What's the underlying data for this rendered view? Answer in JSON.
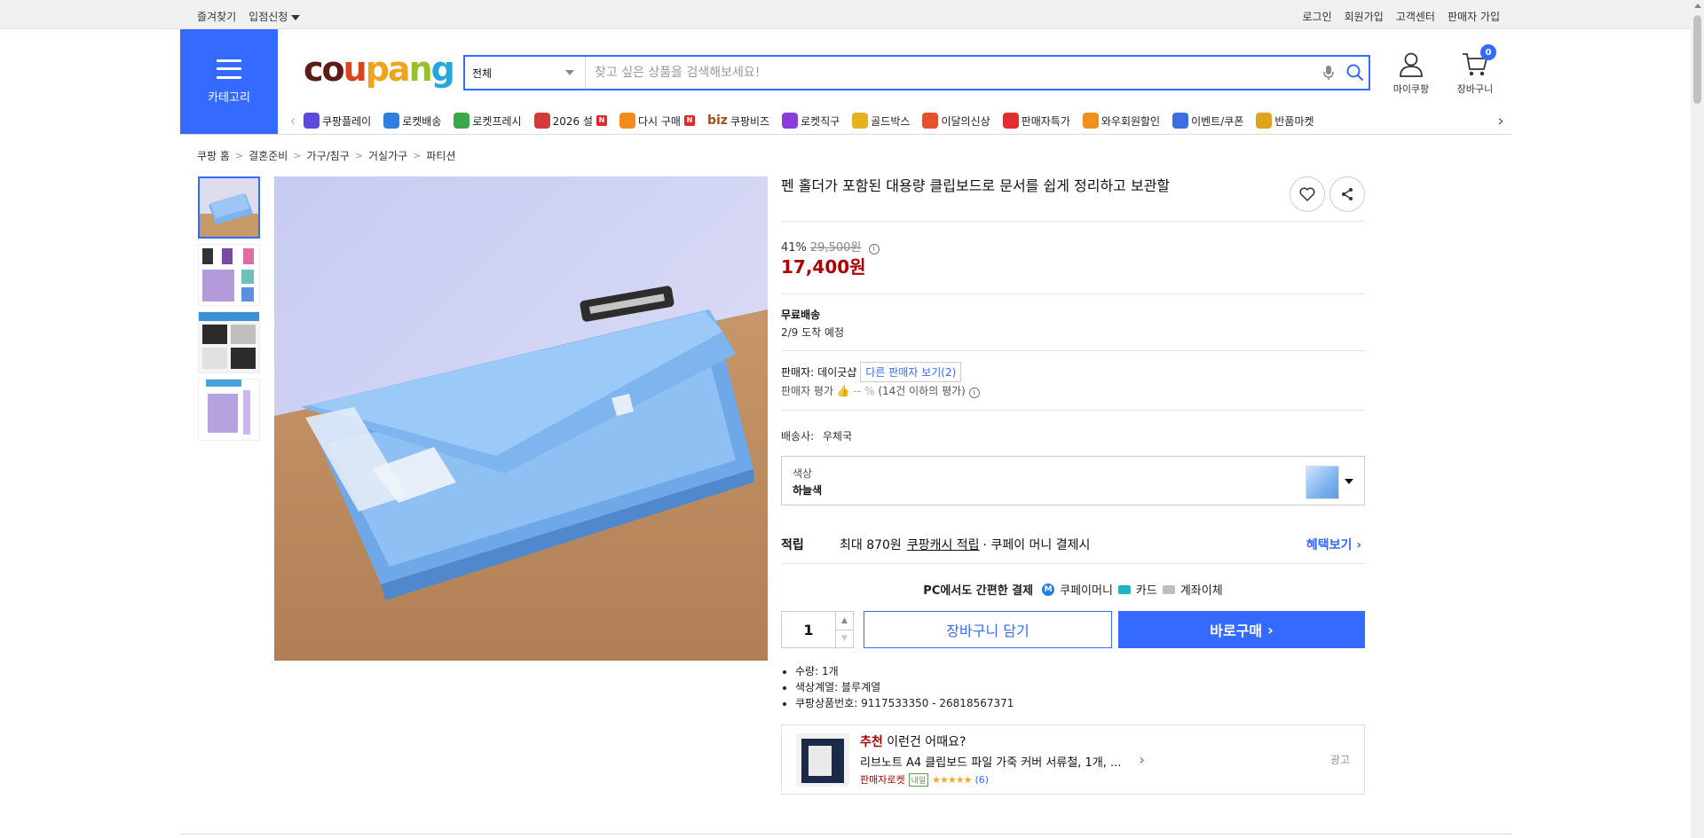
{
  "topbar": {
    "left": [
      "즐겨찾기",
      "입점신청"
    ],
    "right": [
      "로그인",
      "회원가입",
      "고객센터",
      "판매자 가입"
    ]
  },
  "header": {
    "category_label": "카테고리",
    "logo": [
      "c",
      "o",
      "u",
      "p",
      "a",
      "n",
      "g"
    ],
    "search": {
      "category": "전체",
      "placeholder": "찾고 싶은 상품을 검색해보세요!"
    },
    "mycoupang": "마이쿠팡",
    "cart": "장바구니",
    "cart_count": "0"
  },
  "services": [
    {
      "label": "쿠팡플레이",
      "color": "#5a4bdb",
      "icon": "play-icon"
    },
    {
      "label": "로켓배송",
      "color": "#2f7fe0",
      "icon": "rocket-icon"
    },
    {
      "label": "로켓프레시",
      "color": "#3aa84a",
      "icon": "fresh-rocket-icon"
    },
    {
      "label": "2026 설",
      "color": "#d03b3b",
      "icon": "gift-icon",
      "new": "N"
    },
    {
      "label": "다시 구매",
      "color": "#f28b1e",
      "icon": "rebuy-icon",
      "new": "N"
    },
    {
      "label": "쿠팡비즈",
      "color": "#a44d1e",
      "icon": "biz-icon",
      "prefix": "biz"
    },
    {
      "label": "로켓직구",
      "color": "#8a3ddb",
      "icon": "global-icon"
    },
    {
      "label": "골드박스",
      "color": "#e8b21f",
      "icon": "goldbox-icon"
    },
    {
      "label": "이달의신상",
      "color": "#e4512b",
      "icon": "new-product-icon"
    },
    {
      "label": "판매자특가",
      "color": "#e02e2e",
      "icon": "discount-icon"
    },
    {
      "label": "와우회원할인",
      "color": "#f08f1e",
      "icon": "wow-icon"
    },
    {
      "label": "이벤트/쿠폰",
      "color": "#3b6fe0",
      "icon": "coupon-icon"
    },
    {
      "label": "반품마켓",
      "color": "#e0a31e",
      "icon": "market-icon"
    }
  ],
  "breadcrumb": [
    "쿠팡 홈",
    "결혼준비",
    "가구/침구",
    "거실가구",
    "파티션"
  ],
  "product": {
    "title": "펜 홀더가 포함된 대용량 클립보드로 문서를 쉽게 정리하고 보관할",
    "discount": "41%",
    "original_price": "29,500원",
    "price": "17,400원",
    "shipping_title": "무료배송",
    "arrival": "2/9 도착 예정",
    "seller_label": "판매자:",
    "seller": "데이긋샵",
    "other_sellers": "다른 판매자 보기",
    "other_count": "(2)",
    "rating_label": "판매자 평가",
    "rating_value": "-- %",
    "rating_note": "(14건 이하의 평가)",
    "carrier_label": "배송사:",
    "carrier": "우체국",
    "option_label": "색상",
    "option_value": "하늘색",
    "reward_key": "적립",
    "reward_text": "최대 870원",
    "reward_link": "쿠팡캐시 적립",
    "reward_suffix": "· 쿠페이 머니 결제시",
    "reward_more": "혜택보기",
    "pay_title": "PC에서도 간편한 결제",
    "pay_methods": [
      "쿠페이머니",
      "카드",
      "계좌이체"
    ],
    "quantity": "1",
    "cart_button": "장바구니 담기",
    "buy_button": "바로구매",
    "specs": [
      "수량: 1개",
      "색상계열: 블루계열",
      "쿠팡상품번호: 9117533350 - 26818567371"
    ]
  },
  "recommend": {
    "highlight": "추천",
    "title": "이런건 어때요?",
    "item": "리브노트 A4 클립보드 파일 가죽 커버 서류철, 1개, ...",
    "badge": "판매자로켓",
    "badge_day": "내일",
    "stars": "★★★★★",
    "count": "(6)",
    "ad": "광고"
  }
}
